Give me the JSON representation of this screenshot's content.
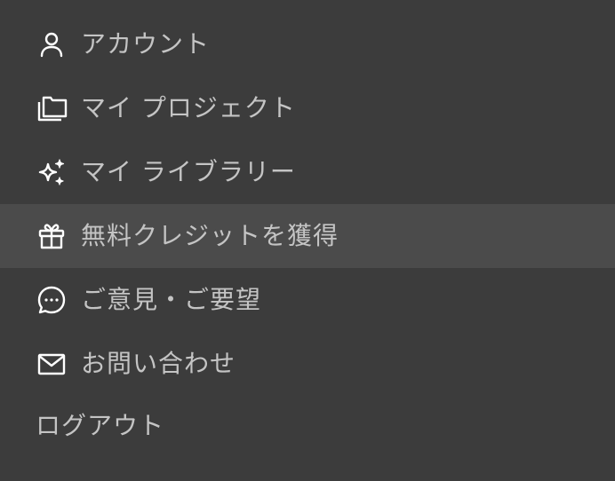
{
  "menu": {
    "items": [
      {
        "label": "アカウント",
        "icon": "user-icon"
      },
      {
        "label": "マイ プロジェクト",
        "icon": "folders-icon"
      },
      {
        "label": "マイ ライブラリー",
        "icon": "sparkles-icon"
      },
      {
        "label": "無料クレジットを獲得",
        "icon": "gift-icon",
        "highlighted": true
      },
      {
        "label": "ご意見・ご要望",
        "icon": "chat-bubble-icon"
      },
      {
        "label": "お問い合わせ",
        "icon": "mail-icon"
      },
      {
        "label": "ログアウト"
      }
    ]
  },
  "colors": {
    "background": "#3c3c3c",
    "highlight": "#4b4b4b",
    "text": "#c4c4c4",
    "icon": "#ffffff"
  }
}
